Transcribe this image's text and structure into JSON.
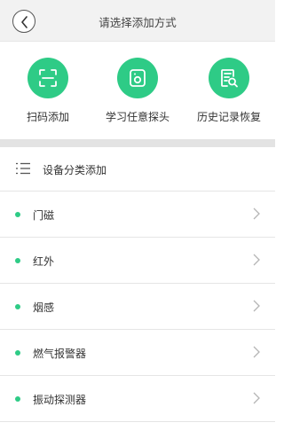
{
  "header": {
    "title": "请选择添加方式",
    "back_icon": "back-icon"
  },
  "options": [
    {
      "label": "扫码添加",
      "icon": "scan-icon"
    },
    {
      "label": "学习任意探头",
      "icon": "learn-probe-icon"
    },
    {
      "label": "历史记录恢复",
      "icon": "history-restore-icon"
    }
  ],
  "section": {
    "label": "设备分类添加",
    "icon": "list-icon"
  },
  "categories": [
    {
      "label": "门磁"
    },
    {
      "label": "红外"
    },
    {
      "label": "烟感"
    },
    {
      "label": "燃气报警器"
    },
    {
      "label": "振动探测器"
    }
  ],
  "colors": {
    "accent": "#2ecb86",
    "header_bg": "#f2f2f2",
    "divider": "#e3e3e3"
  }
}
